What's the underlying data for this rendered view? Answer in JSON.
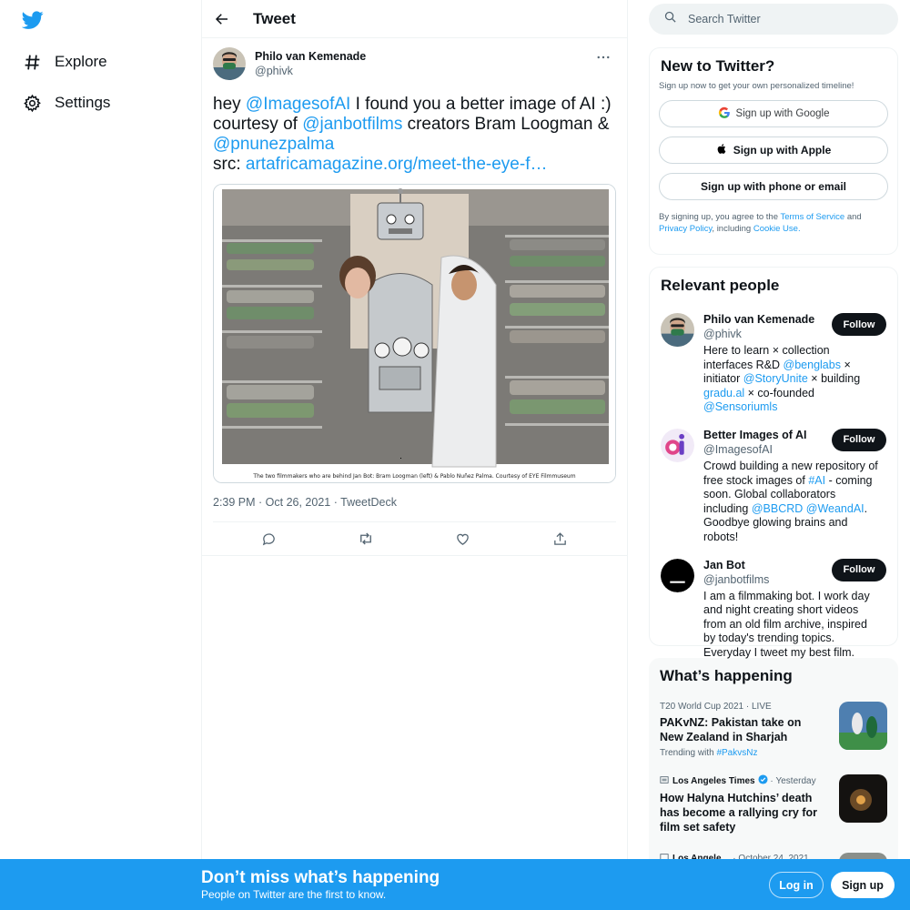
{
  "nav": {
    "items": [
      {
        "label": "Explore",
        "icon": "hashtag-icon"
      },
      {
        "label": "Settings",
        "icon": "gear-icon"
      }
    ]
  },
  "header": {
    "title": "Tweet"
  },
  "tweet": {
    "author_name": "Philo van Kemenade",
    "author_handle": "@phivk",
    "text": {
      "t1": "hey ",
      "m1": "@ImagesofAI",
      "t2": " I found you a better image of AI :) courtesy of ",
      "m2": "@janbotfilms",
      "t3": " creators Bram Loogman & ",
      "m3": "@pnunezpalma",
      "t4": "src: ",
      "link": "artafricamagazine.org/meet-the-eye-f…"
    },
    "image_caption": "The two filmmakers who are behind Jan Bot: Bram Loogman (left) & Pablo Nuñez Palma. Courtesy of EYE Filmmuseum",
    "meta": "2:39 PM · Oct 26, 2021 · TweetDeck"
  },
  "search": {
    "placeholder": "Search Twitter"
  },
  "new_to_twitter": {
    "title": "New to Twitter?",
    "subtitle": "Sign up now to get your own personalized timeline!",
    "google": "Sign up with Google",
    "apple": "Sign up with Apple",
    "phone": "Sign up with phone or email",
    "terms_1": "By signing up, you agree to the ",
    "tos": "Terms of Service",
    "terms_2": " and ",
    "privacy": "Privacy Policy",
    "terms_3": ", including ",
    "cookie": "Cookie Use."
  },
  "relevant": {
    "title": "Relevant people",
    "follow_label": "Follow",
    "people": [
      {
        "name": "Philo van Kemenade",
        "handle": "@phivk",
        "bio": [
          {
            "t": "Here to learn × collection interfaces R&D "
          },
          {
            "l": "@benglabs"
          },
          {
            "t": " × initiator "
          },
          {
            "l": "@StoryUnite"
          },
          {
            "t": " × building "
          },
          {
            "l": "gradu.al"
          },
          {
            "t": " × co-founded "
          },
          {
            "l": "@Sensoriumls"
          }
        ]
      },
      {
        "name": "Better Images of AI",
        "handle": "@ImagesofAI",
        "bio": [
          {
            "t": "Crowd building a new repository of free stock images of "
          },
          {
            "l": "#AI"
          },
          {
            "t": " - coming soon. Global collaborators including "
          },
          {
            "l": "@BBCRD"
          },
          {
            "t": " "
          },
          {
            "l": "@WeandAI"
          },
          {
            "t": ". Goodbye glowing brains and robots!"
          }
        ]
      },
      {
        "name": "Jan Bot",
        "handle": "@janbotfilms",
        "bio": [
          {
            "t": "I am a filmmaking bot. I work day and night creating short videos from an old film archive, inspired by today's trending topics. Everyday I tweet my best film."
          }
        ]
      }
    ]
  },
  "happening": {
    "title": "What’s happening",
    "trends": [
      {
        "context": "T20 World Cup 2021",
        "sep": " · ",
        "status": "LIVE",
        "title": "PAKvNZ: Pakistan take on New Zealand in Sharjah",
        "sub_label": "Trending with ",
        "sub_link": "#PakvsNz"
      },
      {
        "context": "Los Angeles Times",
        "sep": " · ",
        "status": "Yesterday",
        "title": "How Halyna Hutchins’ death has become a rallying cry for film set safety"
      },
      {
        "context": "Los Angele…",
        "sep": " · ",
        "status": "October 24, 2021",
        "title": ""
      }
    ]
  },
  "bottom_bar": {
    "title": "Don’t miss what’s happening",
    "subtitle": "People on Twitter are the first to know.",
    "login": "Log in",
    "signup": "Sign up"
  },
  "colors": {
    "accent": "#1d9bf0",
    "text": "#0f1419",
    "muted": "#536471"
  }
}
